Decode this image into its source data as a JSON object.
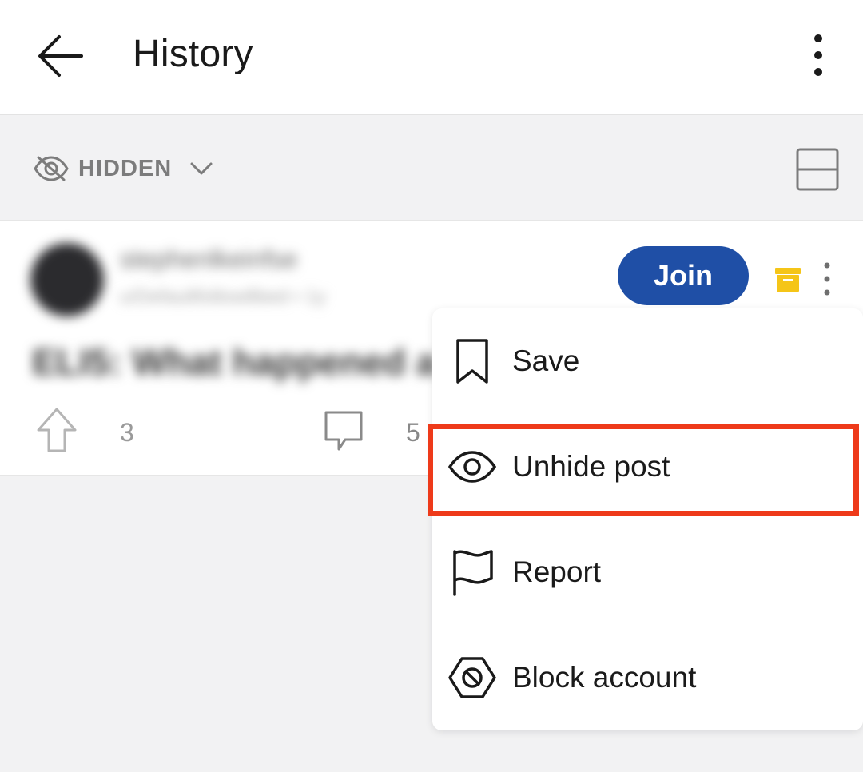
{
  "appbar": {
    "title": "History",
    "back_icon": "arrow-left-icon",
    "menu_icon": "vertical-dots-icon"
  },
  "filter": {
    "label": "HIDDEN",
    "icon": "eye-off-icon",
    "dropdown_icon": "chevron-down-icon",
    "layout_icon": "card-layout-icon"
  },
  "post": {
    "author_name": "stephenlkeinfse",
    "author_meta": "u/Defaultfollow8bed • 1y",
    "title": "ELI5: What happened a",
    "join_label": "Join",
    "vote_count": "3",
    "comment_count": "5"
  },
  "menu": {
    "items": [
      {
        "label": "Save",
        "icon": "bookmark-icon"
      },
      {
        "label": "Unhide post",
        "icon": "eye-icon"
      },
      {
        "label": "Report",
        "icon": "flag-icon"
      },
      {
        "label": "Block account",
        "icon": "block-icon"
      }
    ],
    "highlighted_index": 1
  },
  "colors": {
    "join_button": "#1f4fa6",
    "highlight": "#ee3a1a",
    "archive_icon": "#f5c518",
    "background": "#f2f2f3"
  }
}
